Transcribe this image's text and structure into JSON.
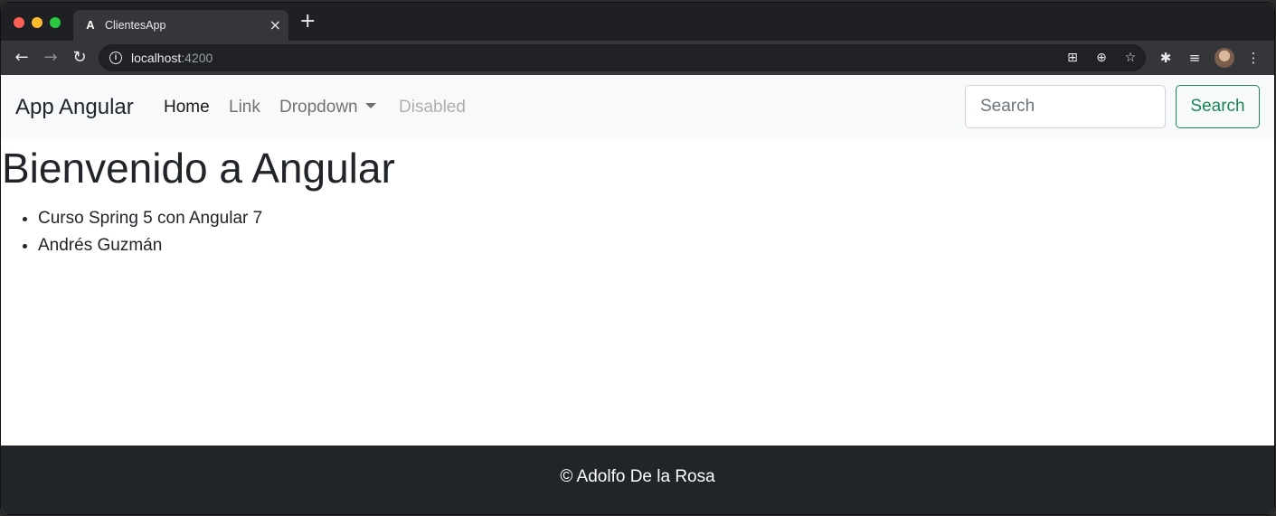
{
  "browser": {
    "tab_title": "ClientesApp",
    "tab_favicon": "A",
    "tab_close": "×",
    "new_tab": "+",
    "url_host": "localhost",
    "url_port": ":4200",
    "icons": {
      "back": "arrow-left-icon",
      "forward": "arrow-right-icon",
      "reload": "reload-icon",
      "info": "info-icon",
      "translate": "translate-icon",
      "zoom": "zoom-icon",
      "bookmark": "star-icon",
      "extensions": "puzzle-icon",
      "media": "playlist-icon",
      "menu": "kebab-menu-icon"
    }
  },
  "navbar": {
    "brand": "App Angular",
    "items": [
      {
        "label": "Home"
      },
      {
        "label": "Link"
      },
      {
        "label": "Dropdown"
      },
      {
        "label": "Disabled"
      }
    ],
    "search_placeholder": "Search",
    "search_button": "Search"
  },
  "main": {
    "heading": "Bienvenido a Angular",
    "list": [
      "Curso Spring 5 con Angular 7",
      "Andrés Guzmán"
    ]
  },
  "footer": {
    "text": "© Adolfo De la Rosa"
  },
  "colors": {
    "accent": "#198754",
    "footer_bg": "#212529",
    "navbar_bg": "#f8f9fa"
  }
}
